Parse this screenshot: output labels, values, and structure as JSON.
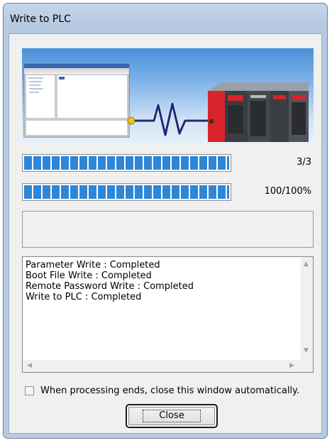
{
  "window": {
    "title": "Write to PLC"
  },
  "progress": [
    {
      "label": "3/3",
      "fraction": 1.0
    },
    {
      "label": "100/100%",
      "fraction": 1.0
    }
  ],
  "status_message": "",
  "log": {
    "lines": [
      "Parameter Write : Completed",
      "Boot File Write : Completed",
      "Remote Password Write : Completed",
      "Write to PLC : Completed"
    ]
  },
  "options": {
    "auto_close_label": "When processing ends, close this window automatically.",
    "auto_close_checked": false
  },
  "buttons": {
    "close_label": "Close"
  },
  "colors": {
    "progress_fill": "#2d86d7",
    "plc_red": "#d8242a",
    "banner_blue": "#4a90d8"
  }
}
